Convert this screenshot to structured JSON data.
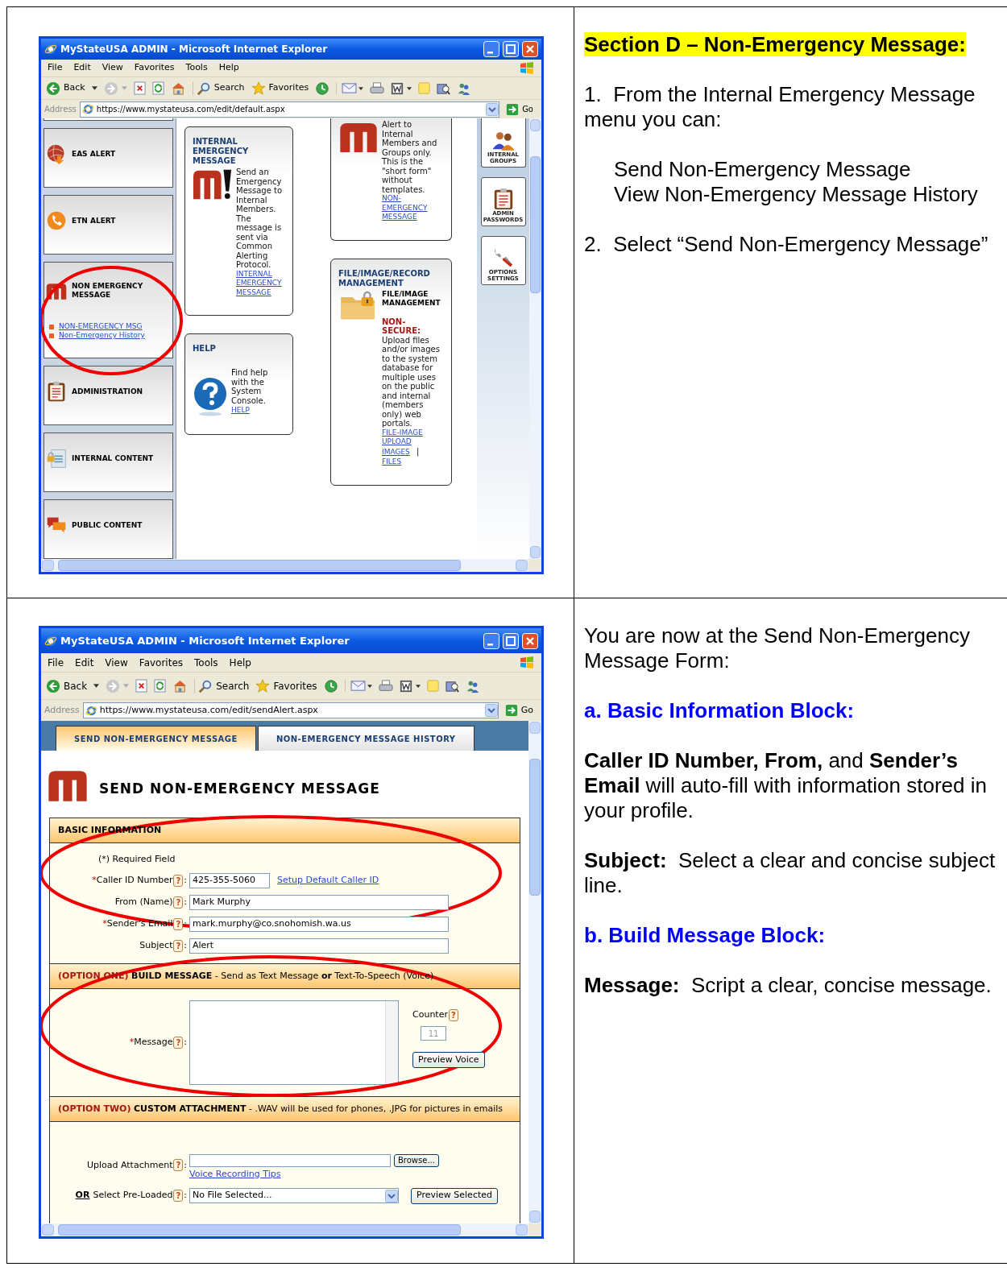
{
  "rows": [
    {
      "screenshot": {
        "kind": "dashboard",
        "title": "MyStateUSA ADMIN - Microsoft Internet Explorer",
        "menu": [
          "File",
          "Edit",
          "View",
          "Favorites",
          "Tools",
          "Help"
        ],
        "toolbar": {
          "back": "Back",
          "search": "Search",
          "favorites": "Favorites"
        },
        "address": {
          "label": "Address",
          "url": "https://www.mystateusa.com/edit/default.aspx",
          "go": "Go"
        },
        "sidebar": [
          {
            "title": "EAS ALERT"
          },
          {
            "title": "ETN ALERT"
          },
          {
            "title": "NON EMERGENCY MESSAGE",
            "links": [
              "NON-EMERGENCY MSG",
              "Non-Emergency History"
            ]
          },
          {
            "title": "ADMINISTRATION"
          },
          {
            "title": "INTERNAL CONTENT"
          },
          {
            "title": "PUBLIC CONTENT"
          }
        ],
        "card_columns": [
          {
            "cards": [
              {
                "kind": "full",
                "title": "INTERNAL EMERGENCY MESSAGE",
                "text": "Send an Emergency Message to Internal Members. The message is sent via Common Alerting Protocol.",
                "links": [
                  {
                    "text": "INTERNAL EMERGENCY MESSAGE"
                  }
                ]
              },
              {
                "kind": "full",
                "title": "HELP",
                "text": "Find help with the System Console.",
                "links": [
                  {
                    "text": "HELP"
                  }
                ]
              }
            ]
          },
          {
            "cards": [
              {
                "kind": "cut",
                "text": "Alert to Internal Members and Groups only. This is the \"short form\" without templates.",
                "links": [
                  {
                    "text": "NON-EMERGENCY MESSAGE"
                  }
                ]
              },
              {
                "kind": "full",
                "title": "FILE/IMAGE/RECORD MANAGEMENT",
                "subtitle": "FILE/IMAGE MANAGEMENT",
                "label": "NON-SECURE:",
                "text": "Upload files and/or images to the system database for multiple uses on the public and internal (members only) web portals.",
                "links": [
                  {
                    "text": "FILE-IMAGE UPLOAD"
                  },
                  {
                    "text": "IMAGES"
                  },
                  {
                    "text": "|",
                    "kind": "separator"
                  },
                  {
                    "text": "FILES"
                  }
                ]
              }
            ]
          }
        ],
        "rail": [
          {
            "label": "INTERNAL GROUPS"
          },
          {
            "label": "ADMIN PASSWORDS"
          },
          {
            "label": "OPTIONS SETTINGS"
          }
        ]
      },
      "notes": [
        {
          "kind": "highlight",
          "text": "Section D – Non-Emergency Message:"
        },
        {
          "kind": "para",
          "text": "1.  From the Internal Emergency Message menu you can:"
        },
        {
          "kind": "indent",
          "lines": [
            "Send Non-Emergency Message",
            "View Non-Emergency Message History"
          ]
        },
        {
          "kind": "para",
          "text": "2.  Select “Send Non-Emergency Message”"
        }
      ]
    },
    {
      "screenshot": {
        "kind": "form",
        "title": "MyStateUSA ADMIN - Microsoft Internet Explorer",
        "menu": [
          "File",
          "Edit",
          "View",
          "Favorites",
          "Tools",
          "Help"
        ],
        "toolbar": {
          "back": "Back",
          "search": "Search",
          "favorites": "Favorites"
        },
        "address": {
          "label": "Address",
          "url": "https://www.mystateusa.com/edit/sendAlert.aspx",
          "go": "Go"
        },
        "tabs": [
          {
            "label": "SEND NON-EMERGENCY MESSAGE",
            "selected": true
          },
          {
            "label": "NON-EMERGENCY MESSAGE HISTORY",
            "selected": false
          }
        ],
        "heading": "SEND NON-EMERGENCY MESSAGE",
        "sections": [
          {
            "kind": "basic",
            "header": {
              "title": "BASIC INFORMATION"
            },
            "note": "(*) Required Field",
            "fields": [
              {
                "required_mark": "*",
                "label": "Caller ID Number",
                "help": "?",
                "after": ":",
                "value": "425-355-5060",
                "link": "Setup Default Caller ID"
              },
              {
                "label": "From (Name)",
                "help": "?",
                "after": ":",
                "value": "Mark Murphy"
              },
              {
                "required_mark": "*",
                "label": "Sender's Email",
                "help": "?",
                "after": ":",
                "value": "mark.murphy@co.snohomish.wa.us"
              },
              {
                "label": "Subject",
                "help": "?",
                "after": ":",
                "value": "Alert"
              }
            ]
          },
          {
            "kind": "message",
            "header": {
              "option": "(OPTION ONE)",
              "title": "BUILD MESSAGE",
              "description": "- Send as Text Message **or** Text-To-Speech (Voice)"
            },
            "field": {
              "required_mark": "*",
              "label": "Message",
              "help": "?",
              "after": ":"
            },
            "counter": {
              "label": "Counter",
              "help": "?",
              "value": "11",
              "disabled": true
            },
            "button": "Preview Voice"
          },
          {
            "kind": "attachment",
            "header": {
              "option": "(OPTION TWO)",
              "title": "CUSTOM ATTACHMENT",
              "description": "- .WAV will be used for phones, .JPG for pictures in emails"
            },
            "upload": {
              "label": "Upload Attachment",
              "help": "?",
              "after": ":",
              "button": "Browse...",
              "link": "Voice Recording Tips"
            },
            "preload": {
              "prefix": "OR",
              "label": "Select Pre-Loaded",
              "help": "?",
              "after": ":",
              "value": "No File Selected...",
              "button": "Preview Selected"
            }
          }
        ]
      },
      "notes": [
        {
          "kind": "para",
          "text": "You are now at the Send Non-Emergency Message Form:"
        },
        {
          "kind": "subheading",
          "text": "a.  Basic Information Block:"
        },
        {
          "kind": "para",
          "text": "**Caller ID Number, From,** and **Sender’s Email** will auto-fill with information stored in your profile."
        },
        {
          "kind": "para",
          "text": "**Subject:**  Select a clear and concise subject line."
        },
        {
          "kind": "subheading",
          "text": "b.  Build Message Block:"
        },
        {
          "kind": "para",
          "text": "**Message:**  Script a clear, concise message."
        }
      ]
    }
  ]
}
